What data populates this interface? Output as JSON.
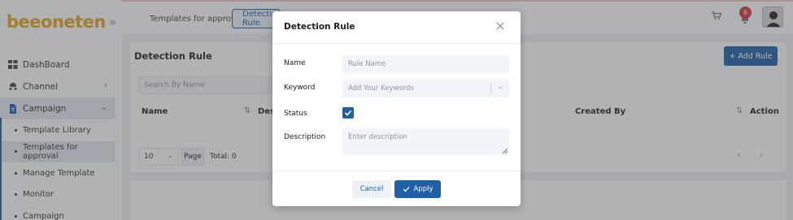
{
  "app": {
    "logo_text": "beeoneten",
    "logo_chevron": "»"
  },
  "sidebar": {
    "items": [
      {
        "label": "DashBoard",
        "icon": "dashboard-icon"
      },
      {
        "label": "Channel",
        "icon": "channel-icon",
        "chevron": "›"
      },
      {
        "label": "Campaign",
        "icon": "campaign-icon",
        "chevron": "⌄"
      }
    ],
    "sub_items": [
      {
        "label": "Template Library"
      },
      {
        "label": "Templates for approval"
      },
      {
        "label": "Manage Template"
      },
      {
        "label": "Monitor"
      },
      {
        "label": "Campaign"
      }
    ]
  },
  "topbar": {
    "breadcrumbs": [
      "Templates for approval",
      "Detection Rule"
    ],
    "notification_count": "6",
    "cart_icon": "cart-icon",
    "bell_icon": "bell-icon"
  },
  "page": {
    "title": "Detection Rule",
    "add_button": "+ Add Rule",
    "search_placeholder": "Search By Name",
    "columns": {
      "name": "Name",
      "description": "Desc",
      "created_by": "Created By",
      "action": "Action"
    },
    "page_size": "10",
    "page_button": "Page",
    "total": "Total: 0",
    "pager": "‹ ›"
  },
  "modal": {
    "title": "Detection Rule",
    "name_label": "Name",
    "name_placeholder": "Rule Name",
    "keyword_label": "Keyword",
    "keyword_placeholder": "Add Your Keywords",
    "status_label": "Status",
    "status_checked": true,
    "description_label": "Description",
    "description_placeholder": "Enter description",
    "cancel_label": "Cancel",
    "apply_label": "Apply"
  },
  "colors": {
    "accent": "#1f5fa8",
    "logo": "#e6a620",
    "badge": "#d8343f"
  }
}
